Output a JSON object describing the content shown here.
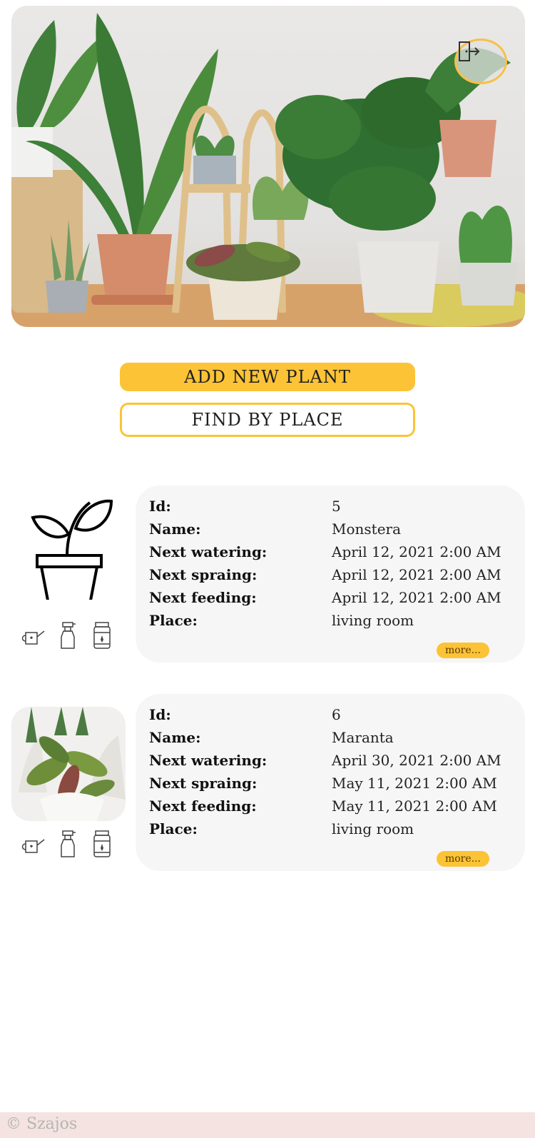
{
  "actions": {
    "add_label": "ADD NEW PLANT",
    "find_label": "FIND BY PLACE"
  },
  "labels": {
    "id": "Id:",
    "name": "Name:",
    "next_watering": "Next watering:",
    "next_spraing": "Next spraing:",
    "next_feeding": "Next feeding:",
    "place": "Place:",
    "more": "more..."
  },
  "plants": [
    {
      "id": "5",
      "name": "Monstera",
      "next_watering": "April 12, 2021 2:00 AM",
      "next_spraing": "April 12, 2021 2:00 AM",
      "next_feeding": "April 12, 2021 2:00 AM",
      "place": "living room",
      "image": "plant-outline-icon"
    },
    {
      "id": "6",
      "name": "Maranta",
      "next_watering": "April 30, 2021 2:00 AM",
      "next_spraing": "May 11, 2021 2:00 AM",
      "next_feeding": "May 11, 2021 2:00 AM",
      "place": "living room",
      "image": "maranta-photo"
    }
  ],
  "care_icons": [
    "watering-can-icon",
    "spray-bottle-icon",
    "fertilizer-jar-icon"
  ],
  "footer": {
    "text": "© Szajos"
  },
  "colors": {
    "accent": "#fcc336",
    "card_bg": "#f6f6f6",
    "footer_bg": "#f4e3e0"
  }
}
